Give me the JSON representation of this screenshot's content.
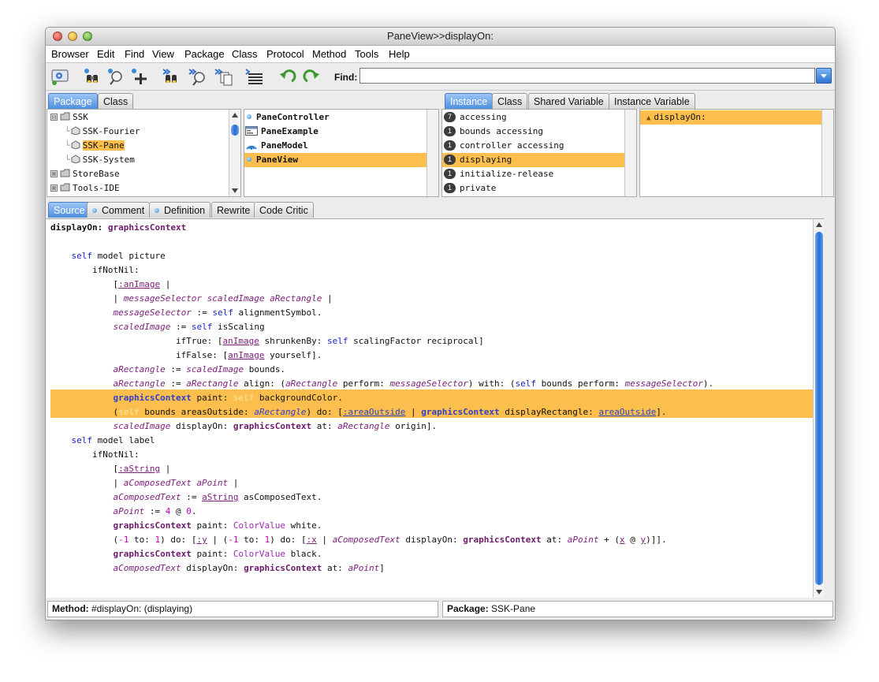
{
  "window": {
    "title": "PaneView>>displayOn:"
  },
  "menu": [
    "Browser",
    "Edit",
    "Find",
    "View",
    "Package",
    "Class",
    "Protocol",
    "Method",
    "Tools",
    "Help"
  ],
  "toolbar": {
    "icons": [
      "browser-icon",
      "find-references-icon",
      "search-icon",
      "add-icon",
      "next-references-icon",
      "next-search-icon",
      "copy-icon",
      "format-icon",
      "undo-icon",
      "redo-icon"
    ],
    "find_label": "Find:",
    "find_value": ""
  },
  "nav_tabs": {
    "package": "Package",
    "class": "Class"
  },
  "packages": [
    {
      "label": "SSK",
      "expander": "⊟"
    },
    {
      "label": "SSK-Fourier"
    },
    {
      "label": "SSK-Pane"
    },
    {
      "label": "SSK-System"
    },
    {
      "label": "StoreBase",
      "expander": "⊞"
    },
    {
      "label": "Tools-IDE",
      "expander": "⊞"
    }
  ],
  "classes": [
    "PaneController",
    "PaneExample",
    "PaneModel",
    "PaneView"
  ],
  "protocol_tabs": {
    "instance": "Instance",
    "class": "Class",
    "shared": "Shared Variable",
    "instvar": "Instance Variable"
  },
  "protocols": [
    {
      "count": "7",
      "label": "accessing"
    },
    {
      "count": "1",
      "label": "bounds accessing"
    },
    {
      "count": "1",
      "label": "controller accessing"
    },
    {
      "count": "1",
      "label": "displaying"
    },
    {
      "count": "1",
      "label": "initialize-release"
    },
    {
      "count": "1",
      "label": "private"
    }
  ],
  "methods": [
    "displayOn:"
  ],
  "editor_tabs": {
    "source": "Source",
    "comment": "Comment",
    "definition": "Definition",
    "rewrite": "Rewrite",
    "critic": "Code Critic"
  },
  "colors": {
    "selection": "#fcbf4d",
    "tab_active": "#4f8fdf"
  },
  "status": {
    "method_label": "Method:",
    "method_value": "#displayOn: (displaying)",
    "package_label": "Package:",
    "package_value": "SSK-Pane"
  }
}
